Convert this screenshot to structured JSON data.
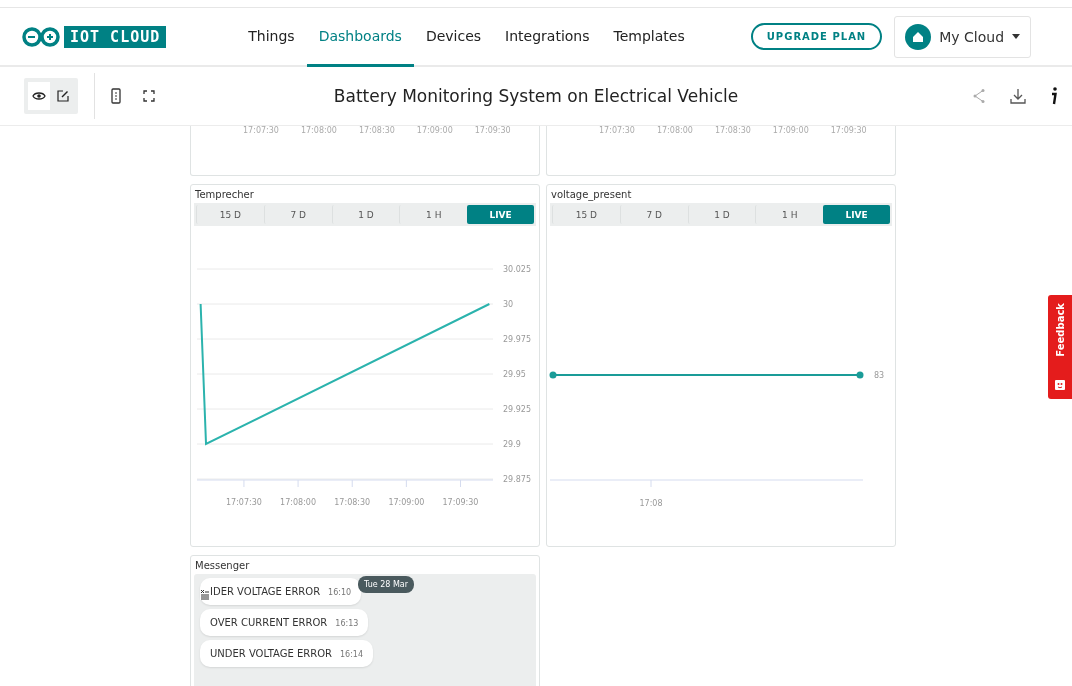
{
  "header": {
    "logo_text": "IOT CLOUD",
    "nav": [
      {
        "label": "Things",
        "selected": false
      },
      {
        "label": "Dashboards",
        "selected": true
      },
      {
        "label": "Devices",
        "selected": false
      },
      {
        "label": "Integrations",
        "selected": false
      },
      {
        "label": "Templates",
        "selected": false
      }
    ],
    "upgrade_button": "UPGRADE PLAN",
    "space": {
      "name": "My Cloud"
    }
  },
  "toolbar": {
    "mode": [
      {
        "kind": "view",
        "selected": true
      },
      {
        "kind": "edit",
        "selected": false
      }
    ],
    "title": "Battery Monitoring System on Electrical Vehicle"
  },
  "top_cards": [
    {
      "x_ticks": [
        "17:07:30",
        "17:08:00",
        "17:08:30",
        "17:09:00",
        "17:09:30"
      ]
    },
    {
      "x_ticks": [
        "17:07:30",
        "17:08:00",
        "17:08:30",
        "17:09:00",
        "17:09:30"
      ]
    }
  ],
  "widgets": [
    {
      "title": "Temprecher",
      "markers": false,
      "ranges": [
        {
          "label": "15 D",
          "selected": false
        },
        {
          "label": "7 D",
          "selected": false
        },
        {
          "label": "1 D",
          "selected": false
        },
        {
          "label": "1 H",
          "selected": false
        },
        {
          "label": "LIVE",
          "selected": true
        }
      ],
      "chart_data": {
        "type": "line",
        "grid": true,
        "x": [
          61626,
          61629,
          61786
        ],
        "series": [
          {
            "color": "#2bb3ad",
            "values": [
              30,
              29.9,
              30
            ]
          }
        ],
        "xlim": [
          61624,
          61788
        ],
        "ylim": [
          29.875,
          30.025
        ],
        "xticks": [
          {
            "value": 61650,
            "label": "17:07:30"
          },
          {
            "value": 61680,
            "label": "17:08:00"
          },
          {
            "value": 61710,
            "label": "17:08:30"
          },
          {
            "value": 61740,
            "label": "17:09:00"
          },
          {
            "value": 61770,
            "label": "17:09:30"
          }
        ],
        "yticks": [
          {
            "value": 30.025,
            "label": "30.025"
          },
          {
            "value": 30,
            "label": "30"
          },
          {
            "value": 29.975,
            "label": "29.975"
          },
          {
            "value": 29.95,
            "label": "29.95"
          },
          {
            "value": 29.925,
            "label": "29.925"
          },
          {
            "value": 29.9,
            "label": "29.9"
          },
          {
            "value": 29.875,
            "label": "29.875"
          }
        ]
      }
    },
    {
      "title": "voltage_present",
      "markers": true,
      "ranges": [
        {
          "label": "15 D",
          "selected": false
        },
        {
          "label": "7 D",
          "selected": false
        },
        {
          "label": "1 D",
          "selected": false
        },
        {
          "label": "1 H",
          "selected": false
        },
        {
          "label": "LIVE",
          "selected": true
        }
      ],
      "value_label": "83",
      "time_label": "17:08"
    }
  ],
  "messenger": {
    "title": "Messenger",
    "date_badge": "Tue 28 Mar",
    "messages": [
      {
        "text": "IDER VOLTAGE ERROR",
        "time": "16:10"
      },
      {
        "text": "OVER CURRENT ERROR",
        "time": "16:13"
      },
      {
        "text": "UNDER VOLTAGE ERROR",
        "time": "16:14"
      }
    ]
  },
  "feedback_tab": "Feedback"
}
